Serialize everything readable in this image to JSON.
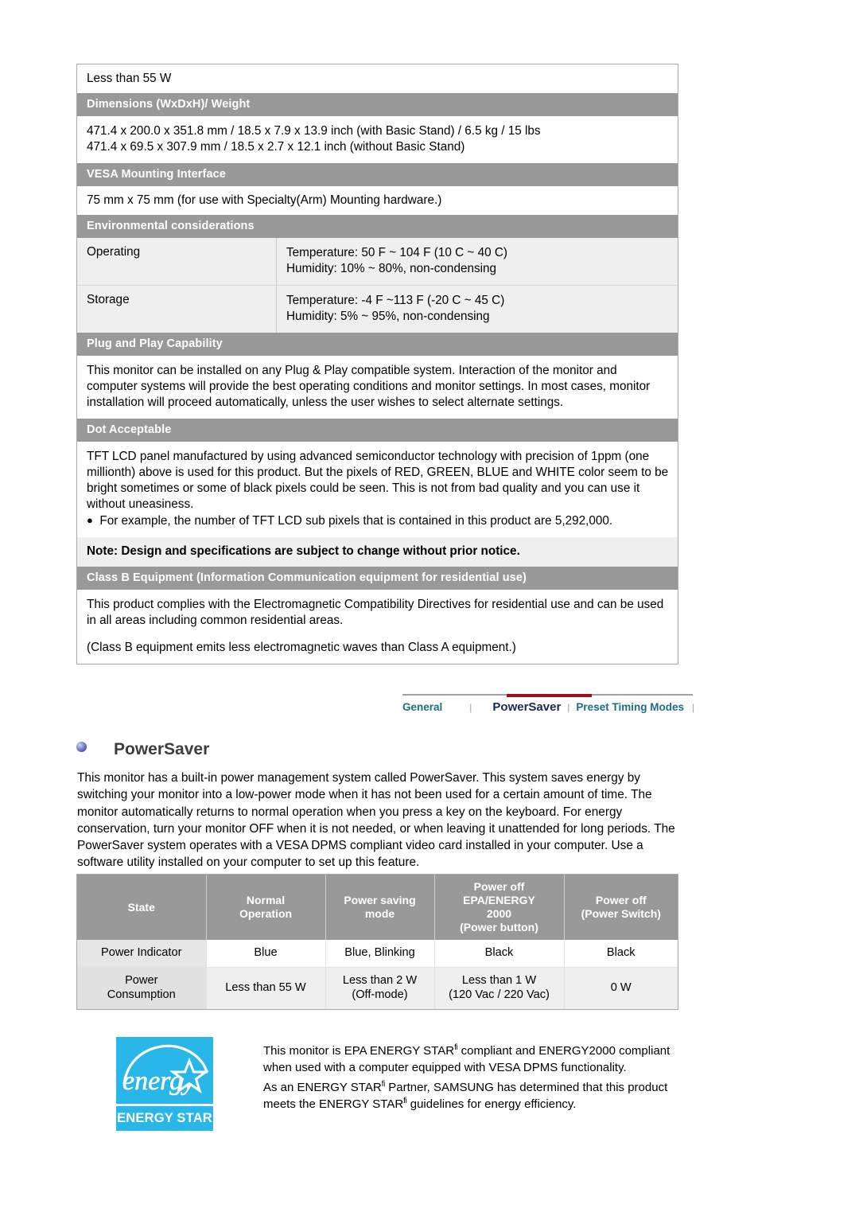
{
  "spec_table": {
    "rows": [
      {
        "kind": "plain",
        "name": "power-consumption-value",
        "text": "Less than 55 W"
      },
      {
        "kind": "band",
        "name": "dimensions-weight-header",
        "text": "Dimensions (WxDxH)/ Weight"
      },
      {
        "kind": "plain",
        "name": "dimensions-weight-value",
        "line1": "471.4 x 200.0 x 351.8 mm / 18.5 x 7.9 x 13.9 inch (with Basic Stand) / 6.5 kg / 15 lbs",
        "line2": "471.4 x 69.5 x 307.9 mm / 18.5 x 2.7 x 12.1 inch (without Basic Stand)"
      },
      {
        "kind": "band",
        "name": "vesa-mounting-header",
        "text": "VESA Mounting Interface"
      },
      {
        "kind": "plain",
        "name": "vesa-mounting-value",
        "text": "75 mm x 75 mm (for use with Specialty(Arm) Mounting hardware.)"
      },
      {
        "kind": "band",
        "name": "environmental-header",
        "text": "Environmental considerations"
      }
    ],
    "environmental": [
      {
        "label": "Operating",
        "temperature": "Temperature: 50 F ~ 104 F (10 C ~ 40 C)",
        "humidity": "Humidity: 10% ~ 80%, non-condensing"
      },
      {
        "label": "Storage",
        "temperature": "Temperature: -4 F ~113 F (-20 C ~ 45 C)",
        "humidity": "Humidity: 5% ~ 95%, non-condensing"
      }
    ],
    "plug_and_play": {
      "header": "Plug and Play Capability",
      "body": "This monitor can be installed on any Plug & Play compatible system. Interaction of the monitor and computer systems will provide the best operating conditions and monitor settings. In most cases, monitor installation will proceed automatically, unless the user wishes to select alternate settings."
    },
    "dot_acceptable": {
      "header": "Dot Acceptable",
      "body": "TFT LCD panel manufactured by using advanced semiconductor technology with precision of 1ppm (one millionth) above is used for this product. But the pixels of RED, GREEN, BLUE and WHITE color seem to be bright sometimes or some of black pixels could be seen. This is not from bad quality and you can use it without uneasiness.",
      "bullet": "For example, the number of TFT LCD sub pixels that is contained in this product are 5,292,000."
    },
    "note": "Note: Design and specifications are subject to change without prior notice.",
    "class_b": {
      "header": "Class B Equipment (Information Communication equipment for residential use)",
      "body1": "This product complies with the Electromagnetic Compatibility Directives for residential use and can be used in all areas including common residential areas.",
      "body2": "(Class B equipment emits less electromagnetic waves than Class A equipment.)"
    }
  },
  "tabnav": {
    "tabs": [
      {
        "label": "General",
        "active": false
      },
      {
        "label": "PowerSaver",
        "active": true
      },
      {
        "label": "Preset Timing Modes",
        "active": false
      }
    ],
    "separator": "|",
    "active_color": "#9b1019",
    "link_color": "#1a6d84",
    "active_text_color": "#172a52"
  },
  "powersaver": {
    "title": "PowerSaver",
    "intro": "This monitor has a built-in power management system called PowerSaver. This system saves energy by switching your monitor into a low-power mode when it has not been used for a certain amount of time. The monitor automatically returns to normal operation when you press a key on the keyboard. For energy conservation, turn your monitor OFF when it is not needed, or when leaving it unattended for long periods. The PowerSaver system operates with a VESA DPMS compliant video card installed in your computer. Use a software utility installed on your computer to set up this feature."
  },
  "powersaver_table": {
    "headers": [
      {
        "line1": "State",
        "line2": "",
        "line3": "",
        "line4": ""
      },
      {
        "line1": "Normal",
        "line2": "Operation",
        "line3": "",
        "line4": ""
      },
      {
        "line1": "Power saving",
        "line2": "mode",
        "line3": "",
        "line4": ""
      },
      {
        "line1": "Power off",
        "line2": "EPA/ENERGY",
        "line3": "2000",
        "line4": "(Power button)"
      },
      {
        "line1": "Power off",
        "line2": "(Power Switch)",
        "line3": "",
        "line4": ""
      }
    ],
    "rows": [
      {
        "label": "Power Indicator",
        "cells": [
          {
            "line1": "Blue",
            "line2": ""
          },
          {
            "line1": "Blue, Blinking",
            "line2": ""
          },
          {
            "line1": "Black",
            "line2": ""
          },
          {
            "line1": "Black",
            "line2": ""
          }
        ]
      },
      {
        "label_line1": "Power",
        "label_line2": "Consumption",
        "cells": [
          {
            "line1": "Less than 55 W",
            "line2": ""
          },
          {
            "line1": "Less than 2 W",
            "line2": "(Off-mode)"
          },
          {
            "line1": "Less than 1 W",
            "line2": "(120 Vac / 220 Vac)"
          },
          {
            "line1": "0 W",
            "line2": ""
          }
        ]
      }
    ]
  },
  "energy_star": {
    "logo_word": "energy",
    "logo_bar_text": "ENERGY STAR",
    "logo_color": "#29b6e8",
    "para1_a": "This monitor is EPA ENERGY STAR",
    "para1_sup": "fi",
    "para1_b": " compliant and ENERGY2000 compliant when used with a computer equipped with VESA DPMS functionality.",
    "para2_a": "As an ENERGY STAR",
    "para2_sup": "fi",
    "para2_b": " Partner, SAMSUNG has determined that this product meets the ENERGY STAR",
    "para2_sup2": "fi",
    "para2_c": " guidelines for energy efficiency."
  }
}
